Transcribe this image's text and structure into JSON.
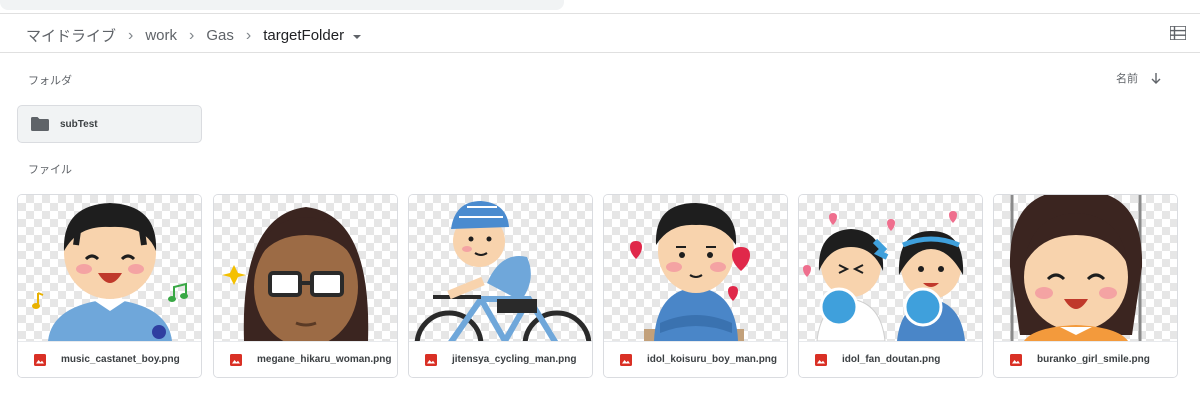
{
  "breadcrumb": {
    "items": [
      "マイドライブ",
      "work",
      "Gas",
      "targetFolder"
    ]
  },
  "sections": {
    "folders_label": "フォルダ",
    "files_label": "ファイル",
    "sort_label": "名前"
  },
  "folders": [
    {
      "name": "subTest"
    }
  ],
  "files": [
    {
      "name": "music_castanet_boy.png"
    },
    {
      "name": "megane_hikaru_woman.png"
    },
    {
      "name": "jitensya_cycling_man.png"
    },
    {
      "name": "idol_koisuru_boy_man.png"
    },
    {
      "name": "idol_fan_doutan.png"
    },
    {
      "name": "buranko_girl_smile.png"
    }
  ],
  "colors": {
    "image_file_icon": "#d93025",
    "folder_icon": "#5f6368"
  },
  "icons": {
    "list_view": "list-view-icon",
    "sort": "arrow-down-icon",
    "folder": "folder-icon",
    "image": "image-file-icon"
  }
}
